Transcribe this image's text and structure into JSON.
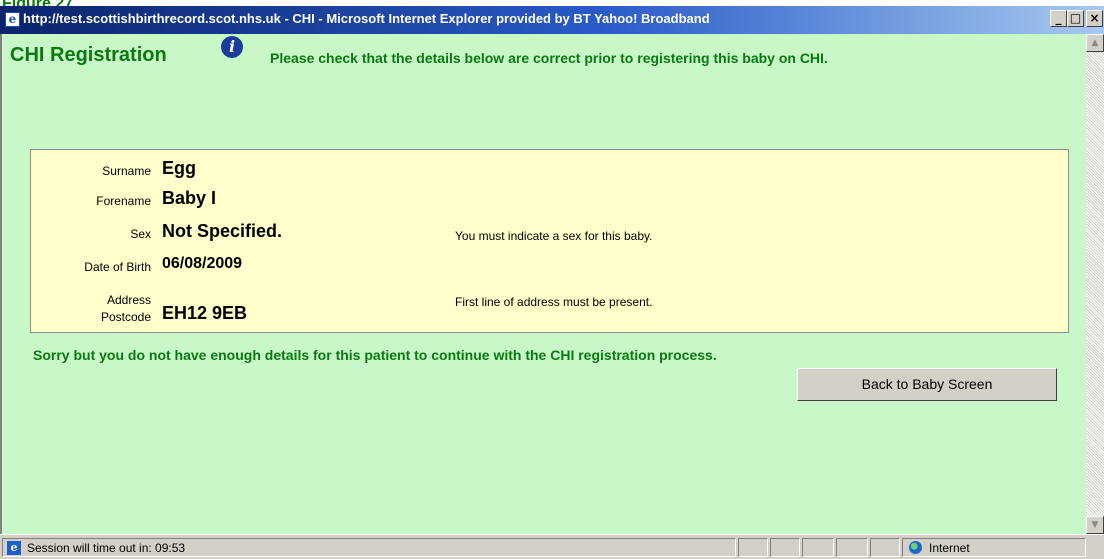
{
  "figure_caption": "Figure 27",
  "window": {
    "title": "http://test.scottishbirthrecord.scot.nhs.uk - CHI - Microsoft Internet Explorer provided by BT Yahoo! Broadband",
    "minimize_glyph": "_",
    "maximize_glyph": "□",
    "close_glyph": "×"
  },
  "page": {
    "heading": "CHI Registration",
    "info_glyph": "i",
    "check_message": "Please check that the details below are correct prior to registering this baby on CHI.",
    "fields": [
      {
        "label": "Surname",
        "value": "Egg",
        "error": ""
      },
      {
        "label": "Forename",
        "value": "Baby I",
        "error": ""
      },
      {
        "label": "Sex",
        "value": "Not Specified.",
        "error": "You must indicate a sex for this baby."
      },
      {
        "label": "Date of Birth",
        "value": "06/08/2009",
        "error": ""
      },
      {
        "label": "Address",
        "value": "",
        "error": "First line of address must be present."
      },
      {
        "label": "Postcode",
        "value": "EH12 9EB",
        "error": ""
      }
    ],
    "sorry_message": "Sorry but you do not have enough details for this patient to continue with the CHI registration process.",
    "back_button_label": "Back to Baby Screen"
  },
  "scrollbar": {
    "up_glyph": "▲",
    "down_glyph": "▼"
  },
  "status_bar": {
    "session_text": "Session will time out in:  09:53",
    "zone_text": "Internet",
    "page_icon_glyph": "e"
  },
  "icons": {
    "title": "ie-page-icon",
    "info": "info-icon",
    "status": "ie-page-icon",
    "zone": "globe-icon"
  },
  "colors": {
    "content_background": "#c8f8c8",
    "panel_background": "#ffffcc",
    "accent_green": "#0a7a10",
    "titlebar_blue": "#0a246a"
  }
}
